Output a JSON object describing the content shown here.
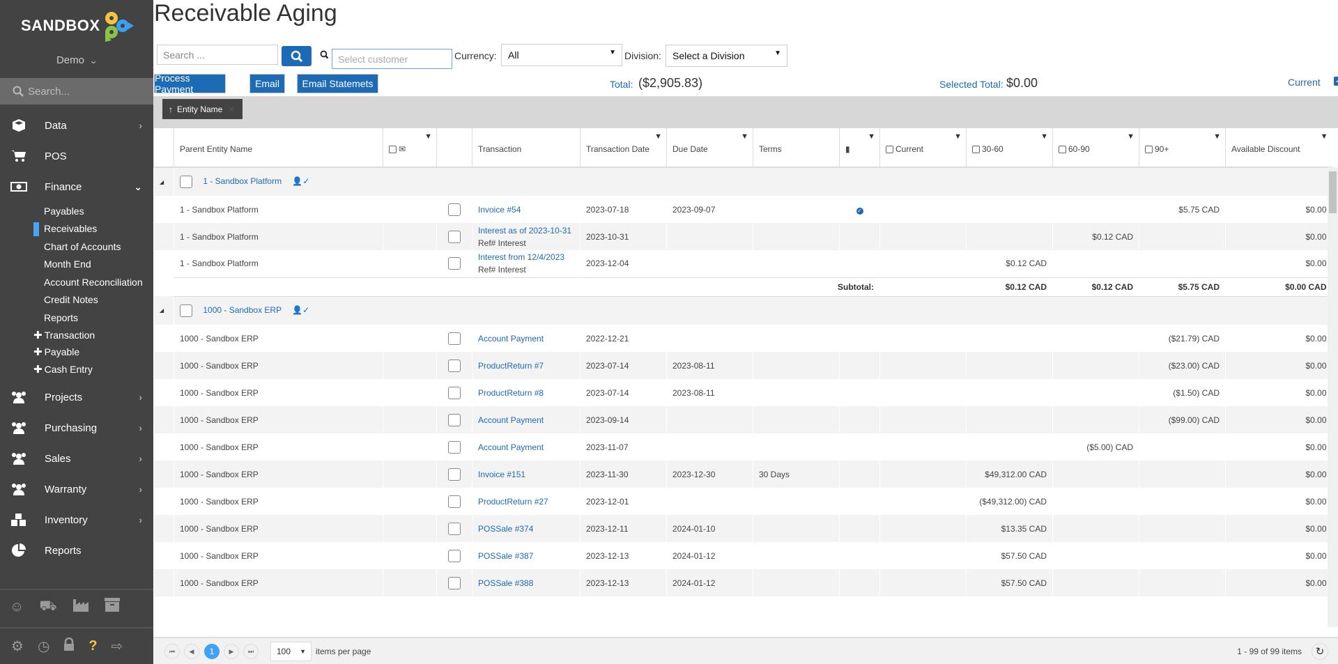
{
  "sidebar": {
    "logo": "SANDBOX",
    "org": "Demo",
    "search_placeholder": "Search...",
    "items": [
      {
        "label": "Data",
        "icon": "cube-icon"
      },
      {
        "label": "POS",
        "icon": "cart-icon"
      },
      {
        "label": "Finance",
        "icon": "money-icon"
      }
    ],
    "finance_sub": [
      "Payables",
      "Receivables",
      "Chart of Accounts",
      "Month End",
      "Account Reconciliation",
      "Credit Notes",
      "Reports"
    ],
    "finance_add": [
      "Transaction",
      "Payable",
      "Cash Entry"
    ],
    "items2": [
      {
        "label": "Projects"
      },
      {
        "label": "Purchasing"
      },
      {
        "label": "Sales"
      },
      {
        "label": "Warranty"
      },
      {
        "label": "Inventory"
      },
      {
        "label": "Reports"
      }
    ],
    "active_sub": "Receivables",
    "accent": "#4aa3f5"
  },
  "page": {
    "title": "Receivable Aging",
    "search_placeholder": "Search ...",
    "customer_placeholder": "Select customer",
    "currency_label": "Currency:",
    "currency_value": "All",
    "division_label": "Division:",
    "division_value": "Select a Division",
    "buttons": {
      "process": "Process Payment",
      "email": "Email",
      "statements": "Email Statemets"
    },
    "total_label": "Total:",
    "total_value": "($2,905.83)",
    "selected_total_label": "Selected Total:",
    "selected_total_value": "$0.00",
    "current_label": "Current",
    "current_checked": true,
    "group_chip": "Entity Name"
  },
  "columns": {
    "parent": "Parent Entity Name",
    "transaction": "Transaction",
    "tdate": "Transaction Date",
    "ddate": "Due Date",
    "terms": "Terms",
    "current": "Current",
    "c3060": "30-60",
    "c6090": "60-90",
    "c90": "90+",
    "discount": "Available Discount"
  },
  "groups": [
    {
      "name": "1 - Sandbox Platform",
      "rows": [
        {
          "parent": "1 - Sandbox Platform",
          "txn": "Invoice #54",
          "ref": "",
          "tdate": "2023-07-18",
          "ddate": "2023-09-07",
          "terms": "",
          "pdf": true,
          "current": "",
          "c3060": "",
          "c6090": "",
          "c90": "$5.75 CAD",
          "disc": "$0.00"
        },
        {
          "parent": "1 - Sandbox Platform",
          "txn": "Interest as of 2023-10-31",
          "ref": "Ref# Interest",
          "tdate": "2023-10-31",
          "ddate": "",
          "terms": "",
          "pdf": false,
          "current": "",
          "c3060": "",
          "c6090": "$0.12 CAD",
          "c90": "",
          "disc": "$0.00"
        },
        {
          "parent": "1 - Sandbox Platform",
          "txn": "Interest from 12/4/2023",
          "ref": "Ref# Interest",
          "tdate": "2023-12-04",
          "ddate": "",
          "terms": "",
          "pdf": false,
          "current": "",
          "c3060": "$0.12 CAD",
          "c6090": "",
          "c90": "",
          "disc": "$0.00"
        }
      ],
      "subtotal": {
        "label": "Subtotal:",
        "c3060": "$0.12 CAD",
        "c6090": "$0.12 CAD",
        "c90": "$5.75 CAD",
        "disc": "$0.00 CAD"
      }
    },
    {
      "name": "1000 - Sandbox ERP",
      "rows": [
        {
          "parent": "1000 - Sandbox ERP",
          "txn": "Account Payment",
          "ref": "",
          "tdate": "2022-12-21",
          "ddate": "",
          "terms": "",
          "pdf": false,
          "current": "",
          "c3060": "",
          "c6090": "",
          "c90": "($21.79) CAD",
          "disc": "$0.00"
        },
        {
          "parent": "1000 - Sandbox ERP",
          "txn": "ProductReturn #7",
          "ref": "",
          "tdate": "2023-07-14",
          "ddate": "2023-08-11",
          "terms": "",
          "pdf": false,
          "current": "",
          "c3060": "",
          "c6090": "",
          "c90": "($23.00) CAD",
          "disc": "$0.00"
        },
        {
          "parent": "1000 - Sandbox ERP",
          "txn": "ProductReturn #8",
          "ref": "",
          "tdate": "2023-07-14",
          "ddate": "2023-08-11",
          "terms": "",
          "pdf": false,
          "current": "",
          "c3060": "",
          "c6090": "",
          "c90": "($1.50) CAD",
          "disc": "$0.00"
        },
        {
          "parent": "1000 - Sandbox ERP",
          "txn": "Account Payment",
          "ref": "",
          "tdate": "2023-09-14",
          "ddate": "",
          "terms": "",
          "pdf": false,
          "current": "",
          "c3060": "",
          "c6090": "",
          "c90": "($99.00) CAD",
          "disc": "$0.00"
        },
        {
          "parent": "1000 - Sandbox ERP",
          "txn": "Account Payment",
          "ref": "",
          "tdate": "2023-11-07",
          "ddate": "",
          "terms": "",
          "pdf": false,
          "current": "",
          "c3060": "",
          "c6090": "($5.00) CAD",
          "c90": "",
          "disc": "$0.00"
        },
        {
          "parent": "1000 - Sandbox ERP",
          "txn": "Invoice #151",
          "ref": "",
          "tdate": "2023-11-30",
          "ddate": "2023-12-30",
          "terms": "30 Days",
          "pdf": false,
          "current": "",
          "c3060": "$49,312.00 CAD",
          "c6090": "",
          "c90": "",
          "disc": "$0.00"
        },
        {
          "parent": "1000 - Sandbox ERP",
          "txn": "ProductReturn #27",
          "ref": "",
          "tdate": "2023-12-01",
          "ddate": "",
          "terms": "",
          "pdf": false,
          "current": "",
          "c3060": "($49,312.00) CAD",
          "c6090": "",
          "c90": "",
          "disc": "$0.00"
        },
        {
          "parent": "1000 - Sandbox ERP",
          "txn": "POSSale #374",
          "ref": "",
          "tdate": "2023-12-11",
          "ddate": "2024-01-10",
          "terms": "",
          "pdf": false,
          "current": "",
          "c3060": "$13.35 CAD",
          "c6090": "",
          "c90": "",
          "disc": "$0.00"
        },
        {
          "parent": "1000 - Sandbox ERP",
          "txn": "POSSale #387",
          "ref": "",
          "tdate": "2023-12-13",
          "ddate": "2024-01-12",
          "terms": "",
          "pdf": false,
          "current": "",
          "c3060": "$57.50 CAD",
          "c6090": "",
          "c90": "",
          "disc": "$0.00"
        },
        {
          "parent": "1000 - Sandbox ERP",
          "txn": "POSSale #388",
          "ref": "",
          "tdate": "2023-12-13",
          "ddate": "2024-01-12",
          "terms": "",
          "pdf": false,
          "current": "",
          "c3060": "$57.50 CAD",
          "c6090": "",
          "c90": "",
          "disc": "$0.00"
        }
      ]
    }
  ],
  "pager": {
    "current_page": "1",
    "page_size": "100",
    "items_per_page_label": "items per page",
    "summary": "1 - 99 of 99 items"
  }
}
